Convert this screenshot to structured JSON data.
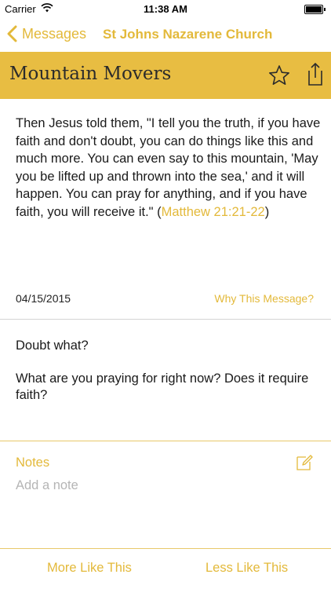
{
  "status_bar": {
    "carrier": "Carrier",
    "time": "11:38 AM",
    "icons": [
      "wifi-icon",
      "battery-icon"
    ]
  },
  "nav": {
    "back_label": "Messages",
    "title": "St Johns Nazarene Church"
  },
  "message": {
    "title": "Mountain Movers",
    "scripture_text": "Then Jesus told them, \"I tell you the truth, if you have faith and don't doubt, you can do things like this and much more. You can even say to this mountain, 'May you be lifted up and thrown into the sea,' and it will happen. You can pray for anything, and if you have faith, you will receive it.\"",
    "scripture_ref": "Matthew 21:21-22",
    "date": "04/15/2015",
    "why_link": "Why This Message?",
    "questions": [
      "Doubt what?",
      "What are you praying for right now? Does it require faith?"
    ]
  },
  "notes": {
    "label": "Notes",
    "placeholder": "Add a note",
    "value": ""
  },
  "footer": {
    "more_label": "More Like This",
    "less_label": "Less Like This"
  },
  "colors": {
    "accent": "#e3b93a",
    "title_bar_bg": "#e8bd42",
    "divider_gold": "#e8c86a",
    "divider_gray": "#d4d4d4"
  }
}
